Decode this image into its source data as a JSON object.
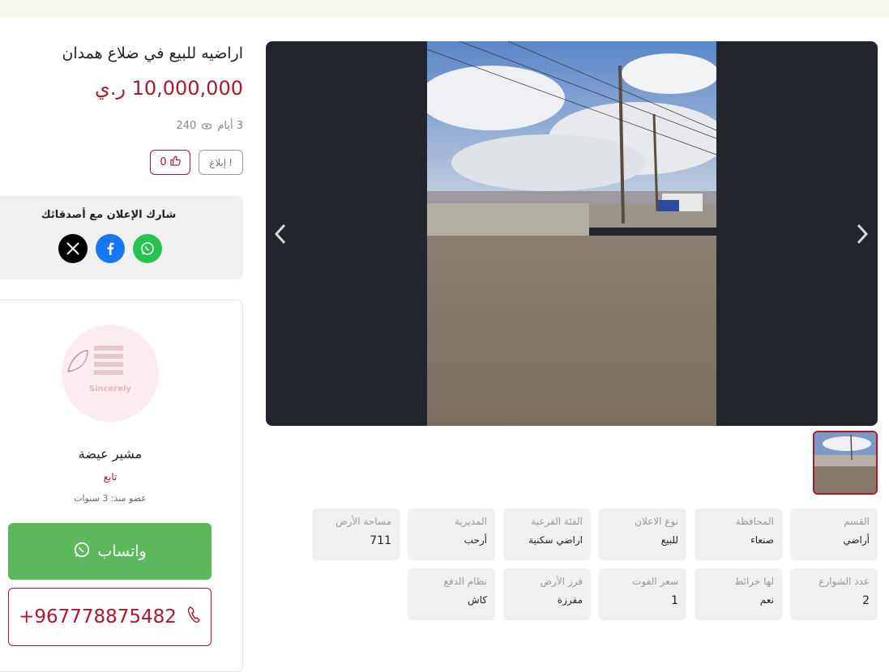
{
  "listing": {
    "title": "اراضيه للبيع في ضلاع همدان",
    "price": "10,000,000 ر.ي",
    "age": "3 أيام",
    "views": "240",
    "likes": "0",
    "report_label": "إبلاغ"
  },
  "share": {
    "title": "شارك الإعلان مع أصدقائك",
    "icons": [
      "x-icon",
      "facebook-icon",
      "whatsapp-icon"
    ]
  },
  "seller": {
    "avatar_text": "Sincerely",
    "name": "مشير عيضة",
    "role": "تابع",
    "member_since": "عضو منذ: 3 سنوات",
    "whatsapp_label": "واتساب",
    "phone": "+967778875482"
  },
  "specs": [
    {
      "label": "القسم",
      "value": "أراضي"
    },
    {
      "label": "المحافظة",
      "value": "صنعاء"
    },
    {
      "label": "نوع الاعلان",
      "value": "للبيع"
    },
    {
      "label": "الفئة الفرعية",
      "value": "اراضي سكنية"
    },
    {
      "label": "المديرية",
      "value": "أرحب"
    },
    {
      "label": "مساحة الأرض",
      "value": "711"
    },
    {
      "label": "عدد الشوارع",
      "value": "2"
    },
    {
      "label": "لها خرائط",
      "value": "نعم"
    },
    {
      "label": "سعر الفوت",
      "value": "1"
    },
    {
      "label": "فرز الأرض",
      "value": "مفرزة"
    },
    {
      "label": "نظام الدفع",
      "value": "كاش"
    }
  ],
  "colors": {
    "accent": "#a8192e",
    "whatsapp": "#5cb85c",
    "facebook": "#1877f2",
    "x": "#000000",
    "gallery_bg": "#22252b"
  }
}
